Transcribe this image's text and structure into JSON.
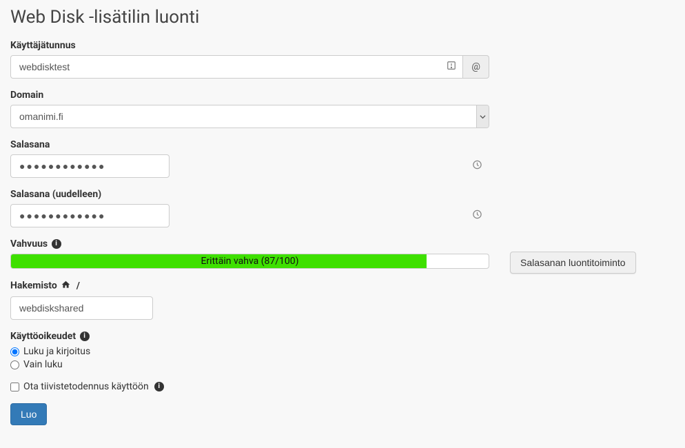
{
  "page": {
    "title": "Web Disk -lisätilin luonti"
  },
  "username": {
    "label": "Käyttäjätunnus",
    "value": "webdisktest",
    "addon": "@"
  },
  "domain": {
    "label": "Domain",
    "value": "omanimi.fi"
  },
  "password": {
    "label": "Salasana",
    "value": "●●●●●●●●●●●●"
  },
  "password_confirm": {
    "label": "Salasana (uudelleen)",
    "value": "●●●●●●●●●●●●"
  },
  "strength": {
    "label": "Vahvuus",
    "text": "Erittäin vahva (87/100)",
    "percent": 87
  },
  "directory": {
    "label_prefix": "Hakemisto",
    "separator": "/",
    "value": "webdiskshared"
  },
  "permissions": {
    "label": "Käyttöoikeudet",
    "options": {
      "readwrite": "Luku ja kirjoitus",
      "readonly": "Vain luku"
    }
  },
  "digest_auth": {
    "label": "Ota tiivistetodennus käyttöön"
  },
  "actions": {
    "create": "Luo",
    "password_generator": "Salasanan luontitoiminto"
  }
}
